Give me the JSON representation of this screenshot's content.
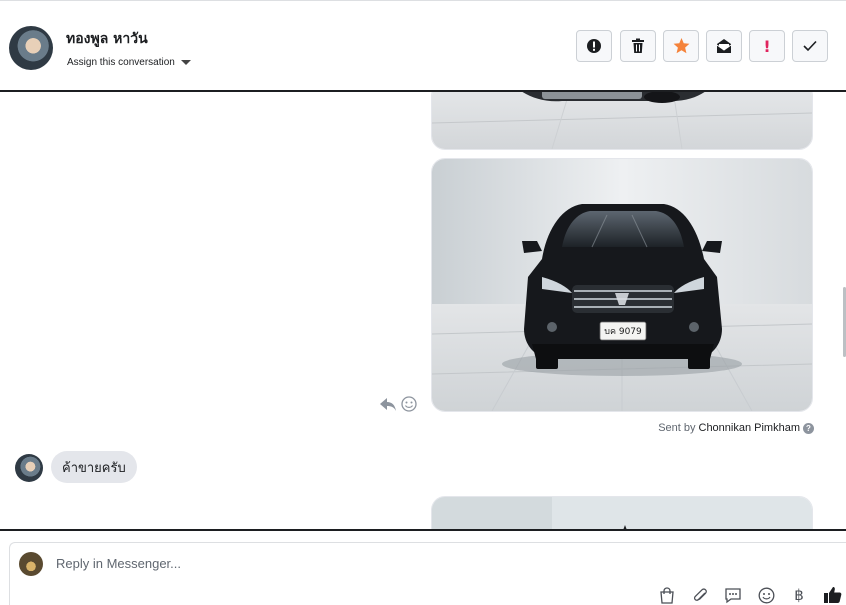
{
  "header": {
    "contact_name": "ทองพูล หาวัน",
    "assign_label": "Assign this conversation",
    "toolbar": [
      {
        "name": "spam-button",
        "icon": "alert-circle-icon"
      },
      {
        "name": "delete-button",
        "icon": "trash-icon"
      },
      {
        "name": "star-button",
        "icon": "star-icon",
        "color": "#f5833b"
      },
      {
        "name": "mark-unread-button",
        "icon": "envelope-icon"
      },
      {
        "name": "follow-up-button",
        "icon": "exclamation-icon",
        "glyph": "!",
        "color": "#e0245e"
      },
      {
        "name": "mark-done-button",
        "icon": "check-icon"
      }
    ]
  },
  "thread": {
    "sent_by_prefix": "Sent by",
    "sent_by_name": "Chonnikan Pimkham",
    "incoming_message": "ค้าขายครับ",
    "plate_text": "บค 9079",
    "plate_sub": "..."
  },
  "composer": {
    "placeholder": "Reply in Messenger...",
    "icons": [
      "shopping-bag-icon",
      "paperclip-icon",
      "saved-replies-icon",
      "emoji-icon",
      "baht-icon",
      "like-icon"
    ],
    "baht_glyph": "฿"
  }
}
